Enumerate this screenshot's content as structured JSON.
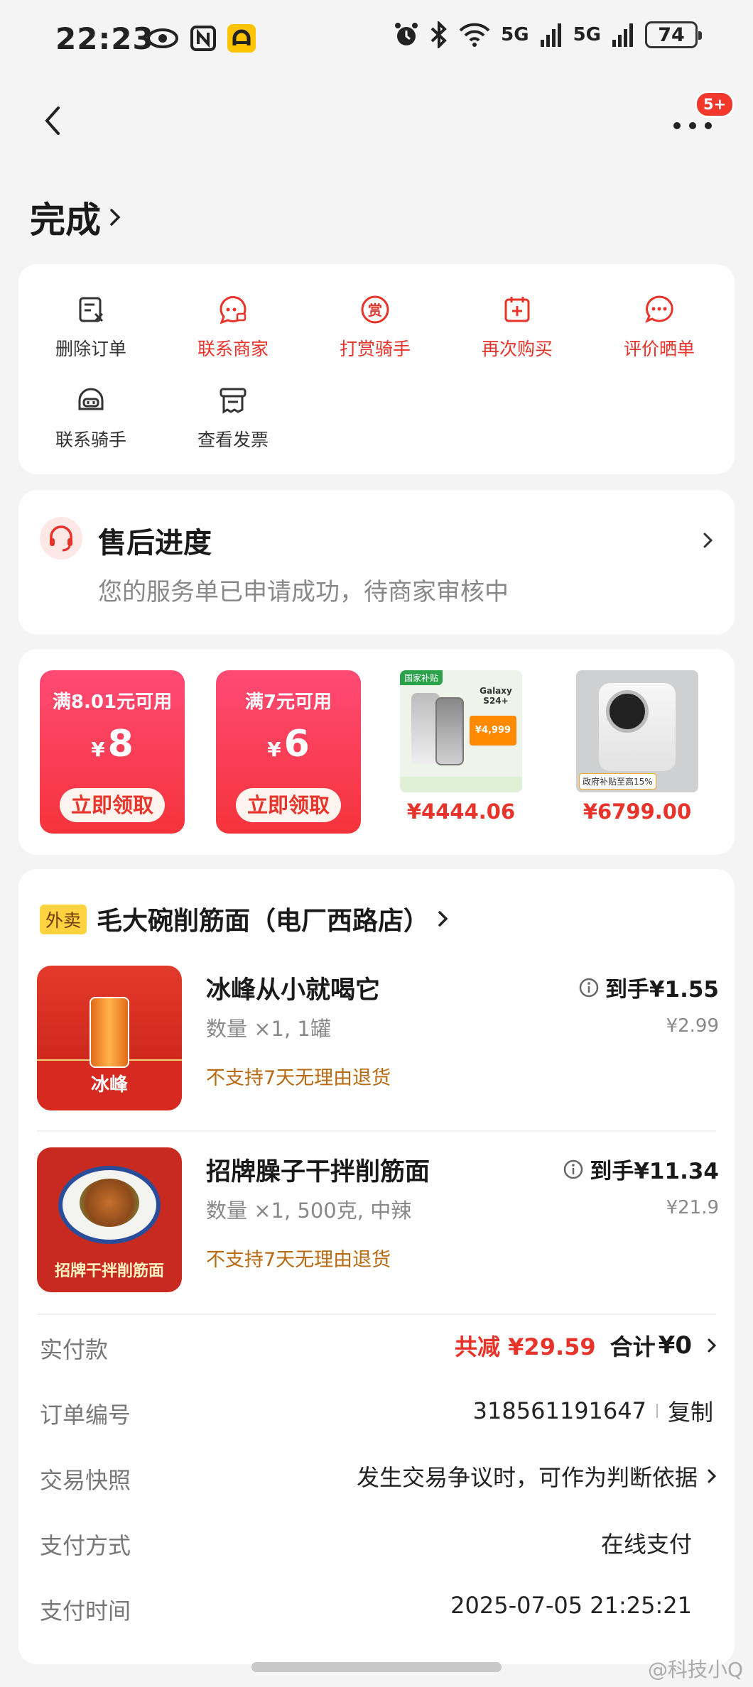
{
  "status_bar": {
    "time": "22:23",
    "battery": "74",
    "network_1": "5G",
    "network_2": "5G",
    "icons": [
      "eye-icon",
      "nfc-icon",
      "app-notification-icon",
      "alarm-icon",
      "bluetooth-icon",
      "wifi-icon",
      "signal-icon"
    ]
  },
  "header": {
    "badge": "5+"
  },
  "order_status": {
    "title": "完成"
  },
  "actions": [
    {
      "label": "删除订单",
      "icon": "delete-order-icon",
      "color": "#333333"
    },
    {
      "label": "联系商家",
      "icon": "contact-merchant-icon",
      "color": "#e8332a"
    },
    {
      "label": "打赏骑手",
      "icon": "tip-rider-icon",
      "color": "#e8332a"
    },
    {
      "label": "再次购买",
      "icon": "reorder-icon",
      "color": "#e8332a"
    },
    {
      "label": "评价晒单",
      "icon": "review-icon",
      "color": "#e8332a"
    },
    {
      "label": "联系骑手",
      "icon": "contact-rider-icon",
      "color": "#333333"
    },
    {
      "label": "查看发票",
      "icon": "invoice-icon",
      "color": "#333333"
    }
  ],
  "after_sales": {
    "title": "售后进度",
    "description": "您的服务单已申请成功，待商家审核中"
  },
  "coupons": [
    {
      "condition": "满8.01元可用",
      "currency": "¥",
      "amount": "8",
      "button": "立即领取"
    },
    {
      "condition": "满7元可用",
      "currency": "¥",
      "amount": "6",
      "button": "立即领取"
    }
  ],
  "products": [
    {
      "price": "¥4444.06",
      "image_text": "Galaxy S24+",
      "tag": "国家补贴",
      "promo_price": "¥4,999"
    },
    {
      "price": "¥6799.00",
      "tag": "政府补贴至高15%"
    }
  ],
  "store": {
    "tag": "外卖",
    "name": "毛大碗削筋面（电厂西路店）"
  },
  "items": [
    {
      "name": "冰峰从小就喝它",
      "qty": "数量 ×1, 1罐",
      "policy": "不支持7天无理由退货",
      "price_label": "到手¥1.55",
      "original_price": "¥2.99",
      "image_caption": "冰峰"
    },
    {
      "name": "招牌臊子干拌削筋面",
      "qty": "数量 ×1, 500克, 中辣",
      "policy": "不支持7天无理由退货",
      "price_label": "到手¥11.34",
      "original_price": "¥21.9",
      "image_caption": "招牌干拌削筋面"
    }
  ],
  "summary": {
    "paid_label": "实付款",
    "discount": "共减 ¥29.59",
    "total_label": "合计",
    "total": "¥0",
    "order_no_label": "订单编号",
    "order_no": "318561191647",
    "copy": "复制",
    "snapshot_label": "交易快照",
    "snapshot_value": "发生交易争议时，可作为判断依据",
    "pay_method_label": "支付方式",
    "pay_method": "在线支付",
    "pay_time_label": "支付时间",
    "pay_time": "2025-07-05 21:25:21"
  },
  "watermark": "@科技小Q"
}
